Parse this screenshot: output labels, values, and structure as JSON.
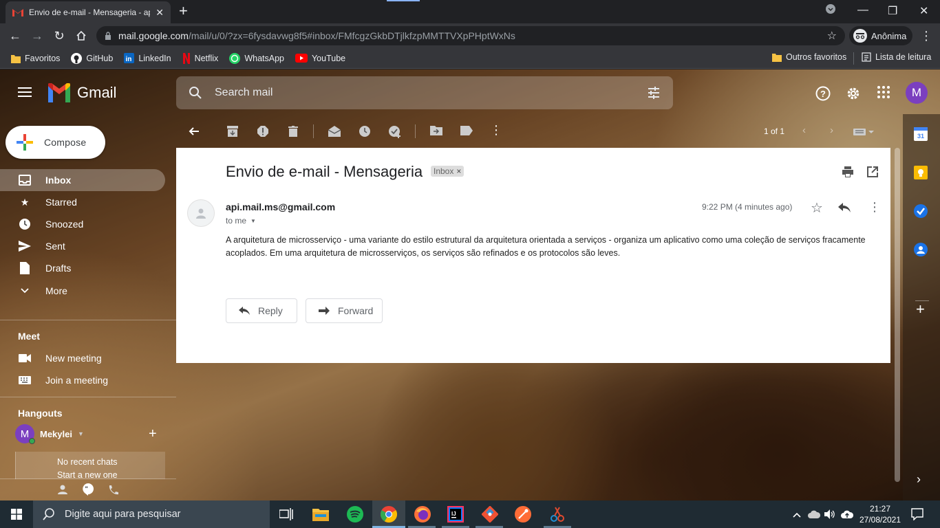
{
  "browser": {
    "tab_title": "Envio de e-mail - Mensageria - api",
    "url_host": "mail.google.com",
    "url_path": "/mail/u/0/?zx=6fysdavwg8f5#inbox/FMfcgzGkbDTjlkfzpMMTTVXpPHptWxNs",
    "profile_label": "Anônima",
    "bookmarks": [
      "Favoritos",
      "GitHub",
      "LinkedIn",
      "Netflix",
      "WhatsApp",
      "YouTube"
    ],
    "bookmarks_right": [
      "Outros favoritos",
      "Lista de leitura"
    ]
  },
  "gmail": {
    "logo_text": "Gmail",
    "search_placeholder": "Search mail",
    "avatar_letter": "M",
    "compose_label": "Compose",
    "nav": [
      "Inbox",
      "Starred",
      "Snoozed",
      "Sent",
      "Drafts",
      "More"
    ],
    "meet": {
      "title": "Meet",
      "items": [
        "New meeting",
        "Join a meeting"
      ]
    },
    "hangouts": {
      "title": "Hangouts",
      "user_name": "Mekylei",
      "user_letter": "M",
      "no_chats": "No recent chats",
      "start_new": "Start a new one"
    },
    "pager": "1 of 1",
    "email": {
      "subject": "Envio de e-mail - Mensageria",
      "label": "Inbox",
      "sender": "api.mail.ms@gmail.com",
      "to": "to me",
      "time": "9:22 PM (4 minutes ago)",
      "body": "A arquitetura de microsserviço - uma variante do estilo estrutural da arquitetura orientada a serviços - organiza um aplicativo como uma coleção de serviços fracamente acoplados. Em uma arquitetura de microsserviços, os serviços são refinados e os protocolos são leves.",
      "reply_label": "Reply",
      "forward_label": "Forward"
    }
  },
  "taskbar": {
    "search_placeholder": "Digite aqui para pesquisar",
    "time": "21:27",
    "date": "27/08/2021"
  },
  "colors": {
    "accent_purple": "#7b3fbf",
    "gmail_red": "#ea4335",
    "taskbar": "#1f2b33"
  }
}
